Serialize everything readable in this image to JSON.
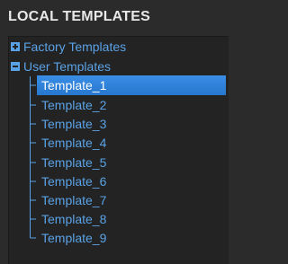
{
  "panel": {
    "title": "LOCAL TEMPLATES"
  },
  "tree": {
    "folders": [
      {
        "label": "Factory Templates",
        "expanded": false,
        "icon": "plus-icon"
      },
      {
        "label": "User Templates",
        "expanded": true,
        "icon": "minus-icon"
      }
    ],
    "items": [
      {
        "label": "Template_1",
        "selected": true
      },
      {
        "label": "Template_2",
        "selected": false
      },
      {
        "label": "Template_3",
        "selected": false
      },
      {
        "label": "Template_4",
        "selected": false
      },
      {
        "label": "Template_5",
        "selected": false
      },
      {
        "label": "Template_6",
        "selected": false
      },
      {
        "label": "Template_7",
        "selected": false
      },
      {
        "label": "Template_8",
        "selected": false
      },
      {
        "label": "Template_9",
        "selected": false
      }
    ]
  },
  "colors": {
    "background": "#2b2b2b",
    "tree_background": "#232323",
    "text_link": "#5aa2e6",
    "selection": "#2e80d6",
    "title": "#e8e8e8"
  }
}
